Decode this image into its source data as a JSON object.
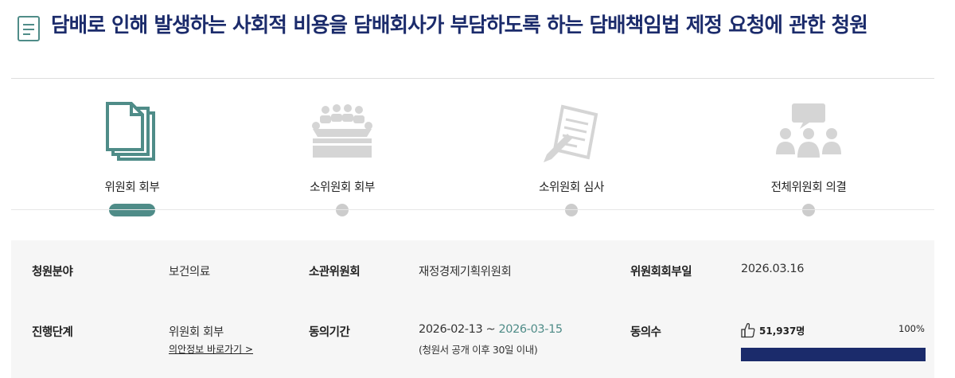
{
  "title": "담배로 인해 발생하는 사회적 비용을 담배회사가 부담하도록 하는 담배책임법 제정 요청에 관한 청원",
  "steps": [
    {
      "label": "위원회 회부",
      "icon": "documents-icon",
      "active": true
    },
    {
      "label": "소위원회 회부",
      "icon": "meeting-icon",
      "active": false
    },
    {
      "label": "소위원회 심사",
      "icon": "review-icon",
      "active": false
    },
    {
      "label": "전체위원회 의결",
      "icon": "discussion-icon",
      "active": false
    }
  ],
  "info": {
    "field_label": "청원분야",
    "field_value": "보건의료",
    "committee_label": "소관위원회",
    "committee_value": "재정경제기획위원회",
    "referral_date_label": "위원회회부일",
    "referral_date_value": "2026.03.16",
    "stage_label": "진행단계",
    "stage_value": "위원회 회부",
    "bill_link": "의안정보 바로가기 >",
    "period_label": "동의기간",
    "period_start": "2026-02-13 ~",
    "period_end": "2026-03-15",
    "period_note": "(청원서 공개 이후 30일 이내)",
    "agree_label": "동의수",
    "agree_count": "51,937명",
    "agree_percent": "100%",
    "agree_progress": 1.0
  },
  "colors": {
    "title": "#1b2b6b",
    "accent": "#4f8c88",
    "progress": "#1b2b6b"
  }
}
